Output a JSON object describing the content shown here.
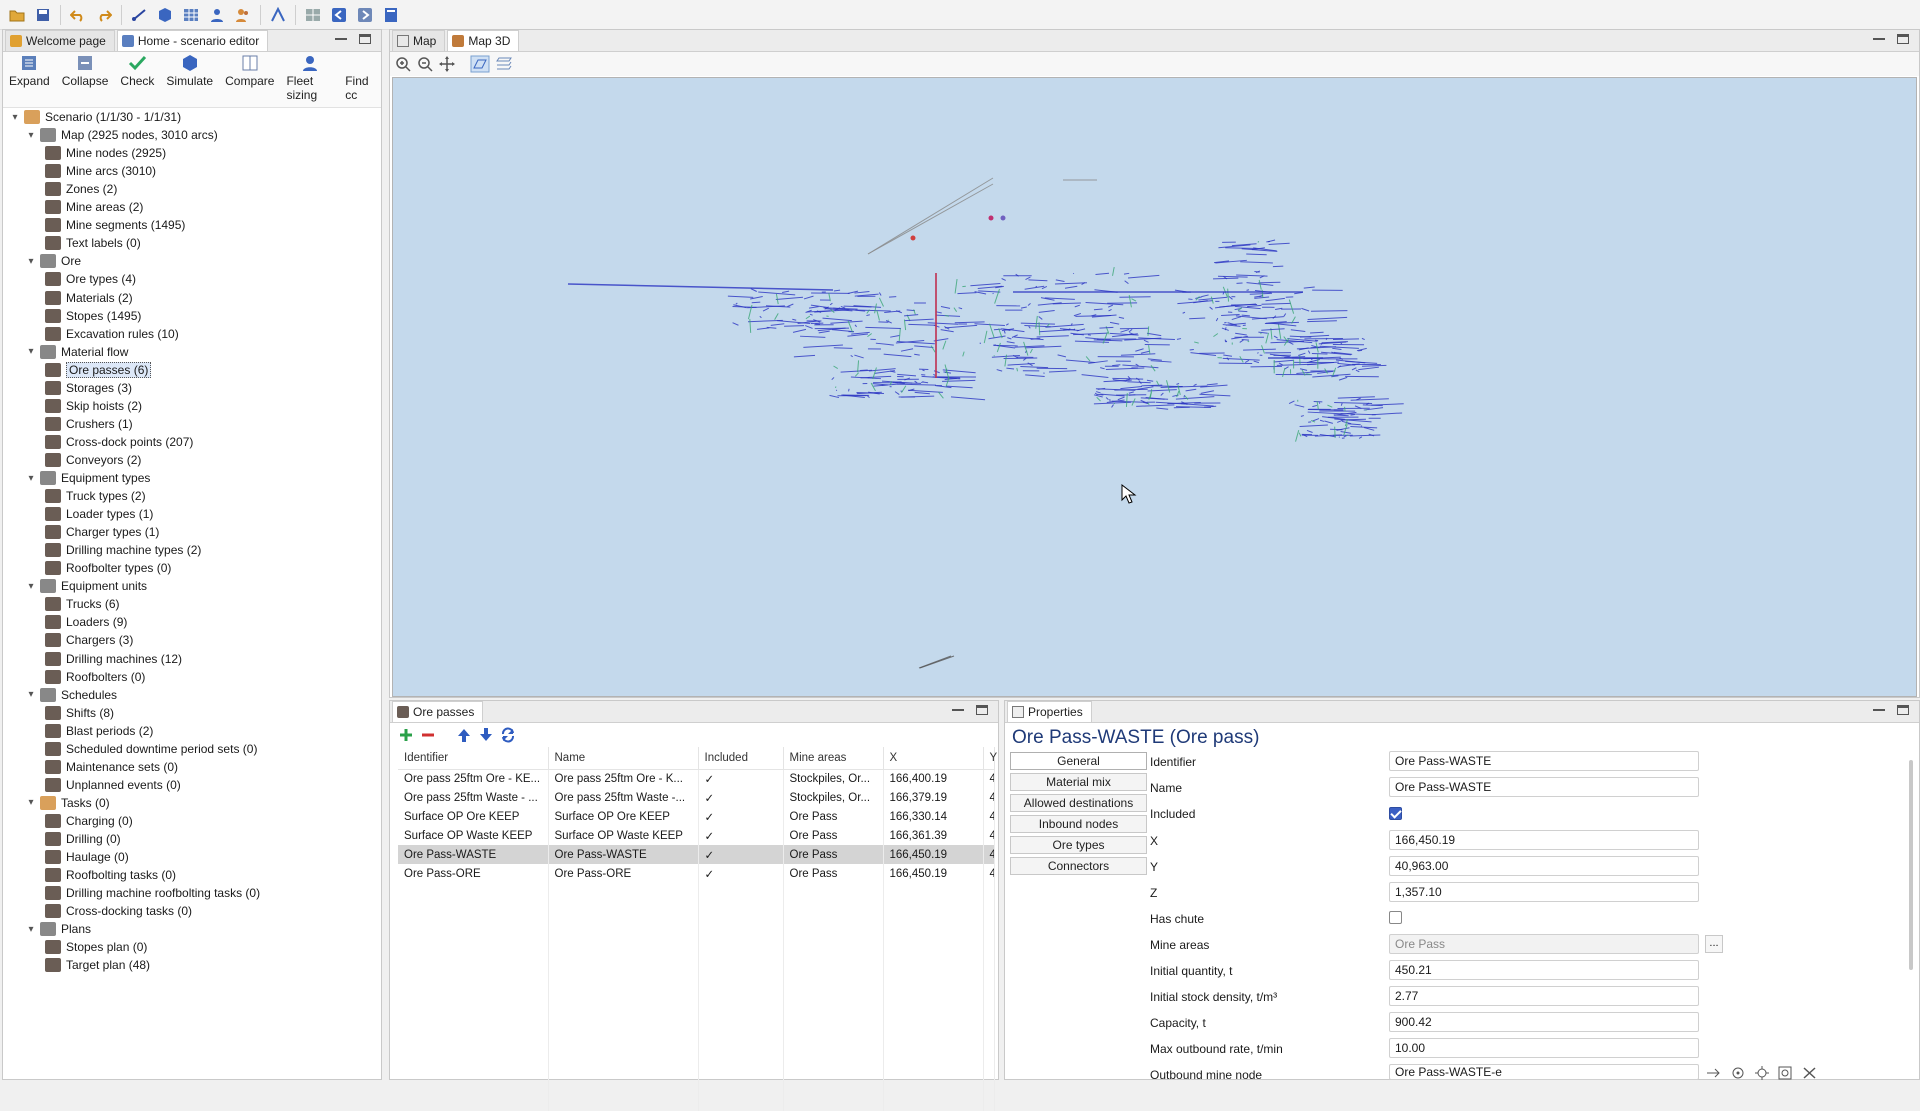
{
  "editor_tabs": {
    "welcome": "Welcome page",
    "home": "Home - scenario editor"
  },
  "actions": [
    "Expand",
    "Collapse",
    "Check",
    "Simulate",
    "Compare",
    "Fleet sizing",
    "Find cc"
  ],
  "tree": [
    {
      "label": "Scenario (1/1/30 - 1/1/31)",
      "level": 0,
      "expanded": true,
      "icon": "scenario-icon"
    },
    {
      "label": "Map (2925 nodes, 3010 arcs)",
      "level": 1,
      "expanded": true,
      "icon": "map-icon"
    },
    {
      "label": "Mine nodes (2925)",
      "level": 2,
      "icon": "node-icon"
    },
    {
      "label": "Mine arcs (3010)",
      "level": 2,
      "icon": "arc-icon"
    },
    {
      "label": "Zones (2)",
      "level": 2,
      "icon": "zone-icon"
    },
    {
      "label": "Mine areas (2)",
      "level": 2,
      "icon": "area-icon"
    },
    {
      "label": "Mine segments (1495)",
      "level": 2,
      "icon": "segment-icon"
    },
    {
      "label": "Text labels (0)",
      "level": 2,
      "icon": "text-label-icon"
    },
    {
      "label": "Ore",
      "level": 1,
      "expanded": true,
      "icon": "ore-icon"
    },
    {
      "label": "Ore types (4)",
      "level": 2,
      "icon": "ore-type-icon"
    },
    {
      "label": "Materials (2)",
      "level": 2,
      "icon": "material-icon"
    },
    {
      "label": "Stopes (1495)",
      "level": 2,
      "icon": "stope-icon"
    },
    {
      "label": "Excavation rules (10)",
      "level": 2,
      "icon": "excavation-icon"
    },
    {
      "label": "Material flow",
      "level": 1,
      "expanded": true,
      "icon": "material-flow-icon"
    },
    {
      "label": "Ore passes (6)",
      "level": 2,
      "selected": true,
      "icon": "ore-pass-icon"
    },
    {
      "label": "Storages (3)",
      "level": 2,
      "icon": "storage-icon"
    },
    {
      "label": "Skip hoists (2)",
      "level": 2,
      "icon": "skip-hoist-icon"
    },
    {
      "label": "Crushers (1)",
      "level": 2,
      "icon": "crusher-icon"
    },
    {
      "label": "Cross-dock points (207)",
      "level": 2,
      "icon": "cross-dock-icon"
    },
    {
      "label": "Conveyors (2)",
      "level": 2,
      "icon": "conveyor-icon"
    },
    {
      "label": "Equipment types",
      "level": 1,
      "expanded": true,
      "icon": "equipment-types-icon"
    },
    {
      "label": "Truck types (2)",
      "level": 2,
      "icon": "truck-icon"
    },
    {
      "label": "Loader types (1)",
      "level": 2,
      "icon": "loader-icon"
    },
    {
      "label": "Charger types (1)",
      "level": 2,
      "icon": "charger-icon"
    },
    {
      "label": "Drilling machine types (2)",
      "level": 2,
      "icon": "drill-icon"
    },
    {
      "label": "Roofbolter types (0)",
      "level": 2,
      "icon": "roofbolter-icon"
    },
    {
      "label": "Equipment units",
      "level": 1,
      "expanded": true,
      "icon": "equipment-units-icon"
    },
    {
      "label": "Trucks (6)",
      "level": 2,
      "icon": "truck-icon"
    },
    {
      "label": "Loaders (9)",
      "level": 2,
      "icon": "loader-icon"
    },
    {
      "label": "Chargers (3)",
      "level": 2,
      "icon": "charger-icon"
    },
    {
      "label": "Drilling machines (12)",
      "level": 2,
      "icon": "drill-icon"
    },
    {
      "label": "Roofbolters (0)",
      "level": 2,
      "icon": "roofbolter-icon"
    },
    {
      "label": "Schedules",
      "level": 1,
      "expanded": true,
      "icon": "schedules-icon"
    },
    {
      "label": "Shifts (8)",
      "level": 2,
      "icon": "shift-icon"
    },
    {
      "label": "Blast periods (2)",
      "level": 2,
      "icon": "blast-icon"
    },
    {
      "label": "Scheduled downtime period sets (0)",
      "level": 2,
      "icon": "downtime-icon"
    },
    {
      "label": "Maintenance sets (0)",
      "level": 2,
      "icon": "maintenance-icon"
    },
    {
      "label": "Unplanned events (0)",
      "level": 2,
      "icon": "event-icon"
    },
    {
      "label": "Tasks (0)",
      "level": 1,
      "expanded": true,
      "icon": "tasks-folder-icon"
    },
    {
      "label": "Charging (0)",
      "level": 2,
      "icon": "charging-task-icon"
    },
    {
      "label": "Drilling (0)",
      "level": 2,
      "icon": "drilling-task-icon"
    },
    {
      "label": "Haulage (0)",
      "level": 2,
      "icon": "haulage-task-icon"
    },
    {
      "label": "Roofbolting tasks (0)",
      "level": 2,
      "icon": "roofbolting-task-icon"
    },
    {
      "label": "Drilling machine roofbolting tasks (0)",
      "level": 2,
      "icon": "drill-roofbolting-task-icon"
    },
    {
      "label": "Cross-docking tasks (0)",
      "level": 2,
      "icon": "cross-docking-task-icon"
    },
    {
      "label": "Plans",
      "level": 1,
      "expanded": true,
      "icon": "plans-icon"
    },
    {
      "label": "Stopes plan (0)",
      "level": 2,
      "icon": "plan-icon"
    },
    {
      "label": "Target plan (48)",
      "level": 2,
      "icon": "plan-icon"
    }
  ],
  "map_tabs": {
    "map": "Map",
    "map3d": "Map 3D"
  },
  "ore_passes": {
    "tab_label": "Ore passes",
    "columns": [
      "Identifier",
      "Name",
      "Included",
      "Mine areas",
      "X",
      "Y"
    ],
    "rows": [
      {
        "identifier": "Ore pass 25ftm Ore - KE...",
        "name": "Ore pass 25ftm Ore - K...",
        "included": "✓",
        "mine_areas": "Stockpiles, Or...",
        "x": "166,400.19",
        "y": "4"
      },
      {
        "identifier": "Ore pass 25ftm Waste - ...",
        "name": "Ore pass 25ftm Waste -...",
        "included": "✓",
        "mine_areas": "Stockpiles, Or...",
        "x": "166,379.19",
        "y": "4"
      },
      {
        "identifier": "Surface OP Ore KEEP",
        "name": "Surface OP Ore KEEP",
        "included": "✓",
        "mine_areas": "Ore Pass",
        "x": "166,330.14",
        "y": "4"
      },
      {
        "identifier": "Surface OP Waste KEEP",
        "name": "Surface OP Waste KEEP",
        "included": "✓",
        "mine_areas": "Ore Pass",
        "x": "166,361.39",
        "y": "4"
      },
      {
        "identifier": "Ore Pass-WASTE",
        "name": "Ore Pass-WASTE",
        "included": "✓",
        "mine_areas": "Ore Pass",
        "x": "166,450.19",
        "y": "4",
        "selected": true
      },
      {
        "identifier": "Ore Pass-ORE",
        "name": "Ore Pass-ORE",
        "included": "✓",
        "mine_areas": "Ore Pass",
        "x": "166,450.19",
        "y": "4"
      }
    ]
  },
  "properties": {
    "tab_label": "Properties",
    "title": "Ore Pass-WASTE (Ore pass)",
    "nav": [
      "General",
      "Material mix",
      "Allowed destinations",
      "Inbound nodes",
      "Ore types",
      "Connectors"
    ],
    "fields": {
      "identifier": {
        "label": "Identifier",
        "value": "Ore Pass-WASTE"
      },
      "name": {
        "label": "Name",
        "value": "Ore Pass-WASTE"
      },
      "included": {
        "label": "Included",
        "checked": true
      },
      "x": {
        "label": "X",
        "value": "166,450.19"
      },
      "y": {
        "label": "Y",
        "value": "40,963.00"
      },
      "z": {
        "label": "Z",
        "value": "1,357.10"
      },
      "has_chute": {
        "label": "Has chute",
        "checked": false
      },
      "mine_areas": {
        "label": "Mine areas",
        "value": "Ore Pass"
      },
      "initial_quantity": {
        "label": "Initial quantity, t",
        "value": "450.21"
      },
      "initial_density": {
        "label": "Initial stock density, t/m³",
        "value": "2.77"
      },
      "capacity": {
        "label": "Capacity, t",
        "value": "900.42"
      },
      "max_outbound": {
        "label": "Max outbound rate, t/min",
        "value": "10.00"
      },
      "outbound_node": {
        "label": "Outbound mine node",
        "value": "Ore Pass-WASTE-e"
      }
    },
    "ellipsis_button": "..."
  },
  "colors": {
    "map_background": "#c4d9ec",
    "tunnel_blue": "#2a33c2",
    "tunnel_green": "#3aa776",
    "selection_gray": "#d4d4d4",
    "checkbox_blue": "#3b5fc4"
  }
}
